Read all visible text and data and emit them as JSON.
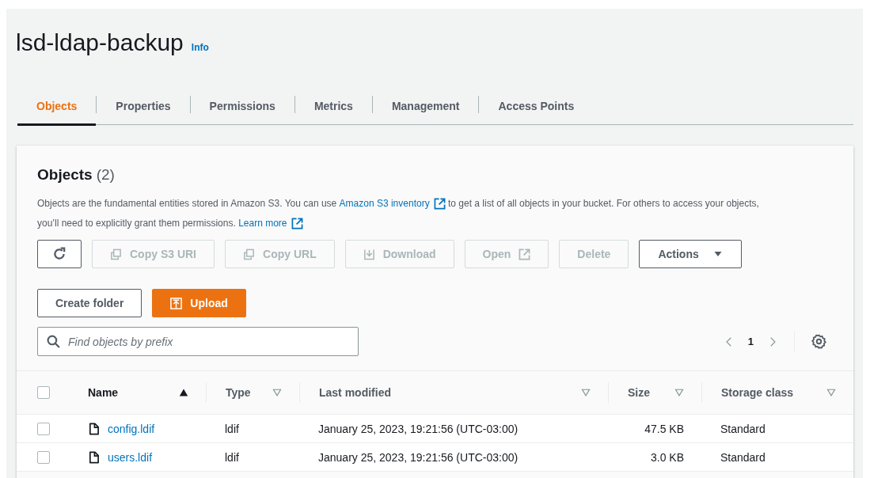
{
  "bucket": {
    "title": "lsd-ldap-backup",
    "info_link": "Info"
  },
  "tabs": [
    {
      "label": "Objects",
      "selected": true
    },
    {
      "label": "Properties",
      "selected": false
    },
    {
      "label": "Permissions",
      "selected": false
    },
    {
      "label": "Metrics",
      "selected": false
    },
    {
      "label": "Management",
      "selected": false
    },
    {
      "label": "Access Points",
      "selected": false
    }
  ],
  "objects_panel": {
    "heading": "Objects",
    "count": "(2)",
    "description": [
      {
        "kind": "text",
        "text": "Objects are the fundamental entities stored in Amazon S3. You can use "
      },
      {
        "kind": "link",
        "text": "Amazon S3 inventory"
      },
      {
        "kind": "text",
        "text": " to get a list of all objects in your bucket. For others to access your objects, you’ll need to explicitly grant them permissions. "
      },
      {
        "kind": "link",
        "text": "Learn more"
      }
    ],
    "toolbar": [
      {
        "kind": "refresh",
        "disabled": false
      },
      {
        "kind": "copy",
        "label": "Copy S3 URI",
        "disabled": true
      },
      {
        "kind": "copy",
        "label": "Copy URL",
        "disabled": true
      },
      {
        "kind": "download",
        "label": "Download",
        "disabled": true
      },
      {
        "kind": "open",
        "label": "Open",
        "disabled": true
      },
      {
        "kind": "plain",
        "label": "Delete",
        "disabled": true
      },
      {
        "kind": "dropdown",
        "label": "Actions",
        "disabled": false
      },
      {
        "kind": "plain",
        "label": "Create folder",
        "disabled": false
      },
      {
        "kind": "upload",
        "label": "Upload",
        "disabled": false
      }
    ],
    "search": {
      "placeholder": "Find objects by prefix"
    },
    "pagination": {
      "page": "1"
    },
    "table": {
      "select_all_checked": false,
      "columns": [
        {
          "label": "Name",
          "sorted": true
        },
        {
          "label": "Type",
          "sorted": false
        },
        {
          "label": "Last modified",
          "sorted": false
        },
        {
          "label": "Size",
          "sorted": false
        },
        {
          "label": "Storage class",
          "sorted": false
        }
      ],
      "rows": [
        {
          "checked": false,
          "name": "config.ldif",
          "type": "ldif",
          "last_modified": "January 25, 2023, 19:21:56 (UTC-03:00)",
          "size": "47.5 KB",
          "storage_class": "Standard"
        },
        {
          "checked": false,
          "name": "users.ldif",
          "type": "ldif",
          "last_modified": "January 25, 2023, 19:21:56 (UTC-03:00)",
          "size": "3.0 KB",
          "storage_class": "Standard"
        }
      ]
    }
  }
}
